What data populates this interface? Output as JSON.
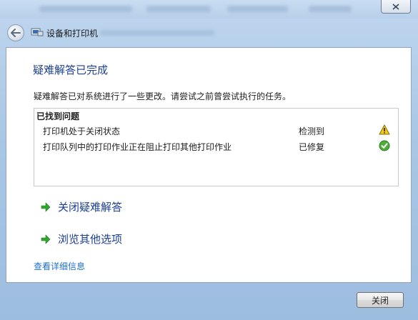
{
  "window": {
    "close_icon": "close-icon"
  },
  "nav": {
    "breadcrumb": "设备和打印机",
    "back_icon": "back-arrow-icon"
  },
  "main": {
    "heading": "疑难解答已完成",
    "description": "疑难解答已对系统进行了一些更改。请尝试之前曾尝试执行的任务。",
    "problems_title": "已找到问题",
    "problems": [
      {
        "text": "打印机处于关闭状态",
        "status": "检测到",
        "icon": "warning-icon",
        "icon_color": "#f2c200"
      },
      {
        "text": "打印队列中的打印作业正在阻止打印其他打印作业",
        "status": "已修复",
        "icon": "check-icon",
        "icon_color": "#3aa12b"
      }
    ],
    "actions": [
      {
        "label": "关闭疑难解答",
        "icon": "green-arrow-icon"
      },
      {
        "label": "浏览其他选项",
        "icon": "green-arrow-icon"
      }
    ],
    "details_link": "查看详细信息"
  },
  "footer": {
    "close_label": "关闭"
  },
  "colors": {
    "heading": "#1c3f94",
    "link": "#1c6fd0",
    "accent_green": "#2fa52f"
  }
}
